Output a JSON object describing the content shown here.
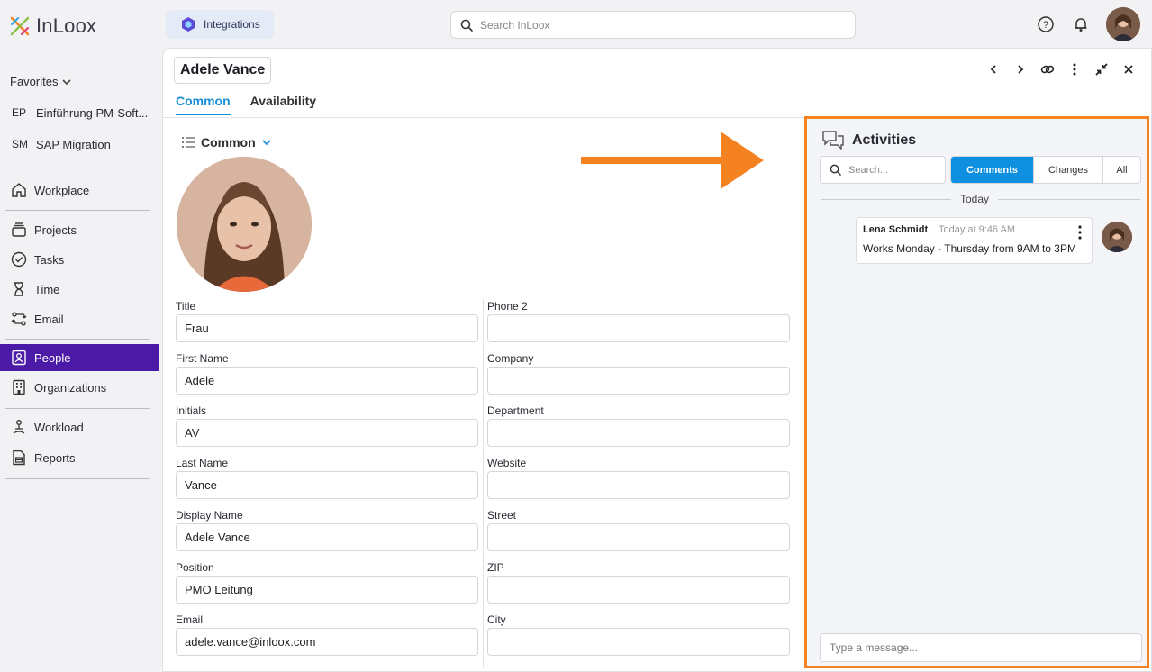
{
  "app": {
    "logo_text": "InLoox"
  },
  "topbar": {
    "integrations_label": "Integrations",
    "search_placeholder": "Search InLoox"
  },
  "sidebar": {
    "favorites_label": "Favorites",
    "favorites": [
      {
        "abbr": "EP",
        "label": "Einführung PM-Soft..."
      },
      {
        "abbr": "SM",
        "label": "SAP Migration"
      }
    ],
    "nav": [
      {
        "label": "Workplace",
        "icon": "home-icon"
      },
      {
        "label": "Projects",
        "icon": "layers-icon"
      },
      {
        "label": "Tasks",
        "icon": "check-circle-icon"
      },
      {
        "label": "Time",
        "icon": "hourglass-icon"
      },
      {
        "label": "Email",
        "icon": "email-route-icon"
      },
      {
        "label": "People",
        "icon": "contact-icon",
        "active": true
      },
      {
        "label": "Organizations",
        "icon": "building-icon"
      },
      {
        "label": "Workload",
        "icon": "workload-icon"
      },
      {
        "label": "Reports",
        "icon": "report-icon"
      }
    ]
  },
  "record": {
    "title": "Adele Vance",
    "tabs": [
      {
        "label": "Common",
        "active": true
      },
      {
        "label": "Availability"
      }
    ],
    "section_label": "Common",
    "left_fields": [
      {
        "label": "Title",
        "value": "Frau"
      },
      {
        "label": "First Name",
        "value": "Adele"
      },
      {
        "label": "Initials",
        "value": "AV"
      },
      {
        "label": "Last Name",
        "value": "Vance"
      },
      {
        "label": "Display Name",
        "value": "Adele Vance"
      },
      {
        "label": "Position",
        "value": "PMO Leitung"
      },
      {
        "label": "Email",
        "value": "adele.vance@inloox.com"
      }
    ],
    "right_fields": [
      {
        "label": "Phone 2",
        "value": ""
      },
      {
        "label": "Company",
        "value": ""
      },
      {
        "label": "Department",
        "value": ""
      },
      {
        "label": "Website",
        "value": ""
      },
      {
        "label": "Street",
        "value": ""
      },
      {
        "label": "ZIP",
        "value": ""
      },
      {
        "label": "City",
        "value": ""
      }
    ]
  },
  "activities": {
    "title": "Activities",
    "search_placeholder": "Search...",
    "filters": [
      {
        "label": "Comments",
        "active": true
      },
      {
        "label": "Changes"
      },
      {
        "label": "All"
      }
    ],
    "day_label": "Today",
    "comments": [
      {
        "author": "Lena Schmidt",
        "time": "Today at 9:46 AM",
        "text": "Works Monday - Thursday from 9AM to 3PM"
      }
    ],
    "message_placeholder": "Type a message..."
  },
  "colors": {
    "accent": "#1a8fd6",
    "nav_active": "#4b1aa6",
    "highlight": "#f58220"
  }
}
